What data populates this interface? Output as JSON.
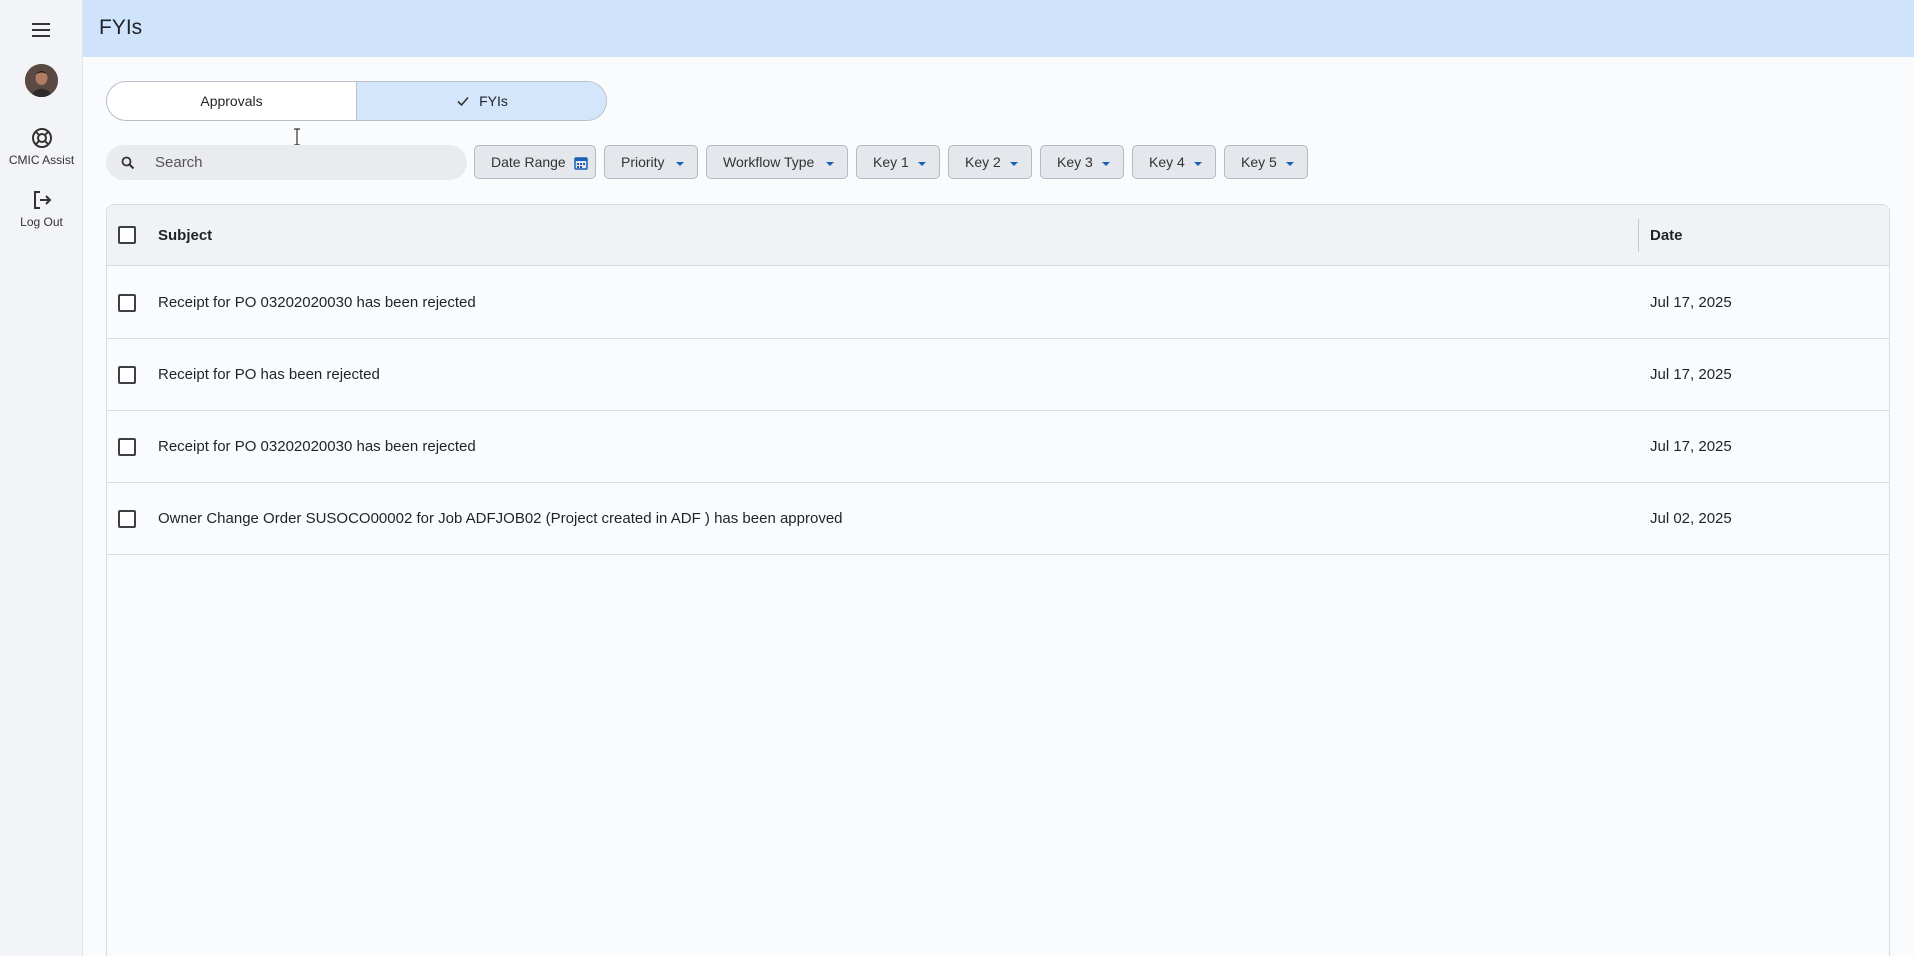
{
  "header": {
    "title": "FYIs"
  },
  "rail": {
    "menu_icon": "hamburger-icon",
    "avatar": "user-avatar",
    "items": [
      {
        "label": "CMIC Assist",
        "icon": "lifebuoy-icon"
      },
      {
        "label": "Log Out",
        "icon": "logout-icon"
      }
    ]
  },
  "tabs": [
    {
      "label": "Approvals",
      "active": false
    },
    {
      "label": "FYIs",
      "active": true,
      "icon": "check-icon"
    }
  ],
  "search": {
    "placeholder": "Search",
    "value": ""
  },
  "filters": [
    {
      "label": "Date Range",
      "icon": "calendar-icon"
    },
    {
      "label": "Priority",
      "icon": "caret-down-icon"
    },
    {
      "label": "Workflow Type",
      "icon": "caret-down-icon"
    },
    {
      "label": "Key 1",
      "icon": "caret-down-icon"
    },
    {
      "label": "Key 2",
      "icon": "caret-down-icon"
    },
    {
      "label": "Key 3",
      "icon": "caret-down-icon"
    },
    {
      "label": "Key 4",
      "icon": "caret-down-icon"
    },
    {
      "label": "Key 5",
      "icon": "caret-down-icon"
    }
  ],
  "table": {
    "columns": [
      "Subject",
      "Date"
    ],
    "rows": [
      {
        "subject": "Receipt for PO 03202020030 has been rejected",
        "date": "Jul 17, 2025"
      },
      {
        "subject": "Receipt for PO has been rejected",
        "date": "Jul 17, 2025"
      },
      {
        "subject": "Receipt for PO 03202020030 has been rejected",
        "date": "Jul 17, 2025"
      },
      {
        "subject": "Owner Change Order SUSOCO00002 for Job ADFJOB02 (Project created in ADF ) has been approved",
        "date": "Jul 02, 2025"
      }
    ]
  },
  "colors": {
    "header_bg": "#cfe4fb",
    "active_tab_bg": "#d4e6fb",
    "accent": "#1a5fb4"
  }
}
